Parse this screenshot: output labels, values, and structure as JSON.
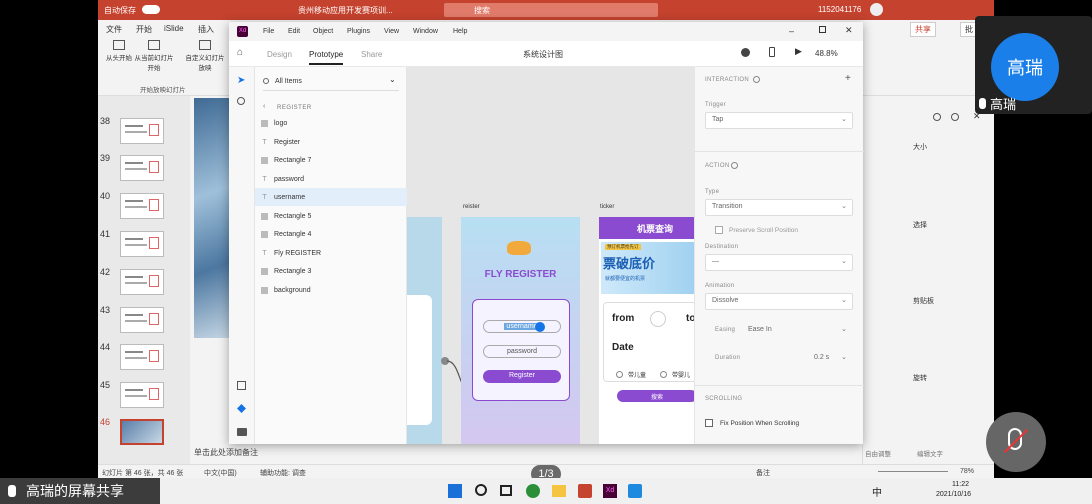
{
  "ppt": {
    "autosave": "自动保存",
    "doc_title": "贵州移动应用开发赛项训...",
    "search": "搜索",
    "user_id": "1152041176",
    "tabs": [
      "文件",
      "开始",
      "iSlide",
      "插入"
    ],
    "share": "共享",
    "comment": "批",
    "ribbon_buttons": [
      "从头开始",
      "从当前幻灯片开始",
      "自定义幻灯片放映"
    ],
    "ribbon_group": "开始放映幻灯片",
    "slide_numbers": [
      "38",
      "39",
      "40",
      "41",
      "42",
      "43",
      "44",
      "45",
      "46"
    ],
    "notes_placeholder": "单击此处添加备注",
    "status_left": "幻灯片 第 46 张，共 46 张",
    "status_lang": "中文(中国)",
    "status_access": "辅助功能: 调查",
    "status_notes": "备注",
    "zoom": "78%",
    "right_panel": {
      "size": "大小",
      "select": "选择",
      "clipboard": "剪贴板",
      "rotate": "旋转",
      "bottom_left": "自由调整",
      "bottom_right": "编辑文字"
    }
  },
  "xd": {
    "menu": [
      "File",
      "Edit",
      "Object",
      "Plugins",
      "View",
      "Window",
      "Help"
    ],
    "modes": [
      "Design",
      "Prototype",
      "Share"
    ],
    "doc_name": "系统设计图",
    "zoom": "48.8%",
    "layers_search": "All Items",
    "layers_header": "REGISTER",
    "layers": [
      {
        "name": "logo",
        "kind": "img"
      },
      {
        "name": "Register",
        "kind": "text"
      },
      {
        "name": "Rectangle 7",
        "kind": "rect"
      },
      {
        "name": "password",
        "kind": "text"
      },
      {
        "name": "username",
        "kind": "text"
      },
      {
        "name": "Rectangle 5",
        "kind": "rect"
      },
      {
        "name": "Rectangle 4",
        "kind": "rect"
      },
      {
        "name": "Fly REGISTER",
        "kind": "text"
      },
      {
        "name": "Rectangle 3",
        "kind": "rect"
      },
      {
        "name": "background",
        "kind": "img"
      }
    ],
    "artboards": {
      "register_label": "reister",
      "ticket_label": "ticker",
      "register_title": "FLY REGISTER",
      "username": "username",
      "password": "password",
      "register_button": "Register",
      "ticket_header": "机票查询",
      "ticket_banner_tag": "预订机票抢先订",
      "ticket_banner_big": "票破底价",
      "ticket_banner_small": "就都要便宜的机票",
      "from": "from",
      "to": "to",
      "date": "Date",
      "child": "带儿童",
      "infant": "带婴儿",
      "search": "搜索"
    },
    "props": {
      "interaction": "INTERACTION",
      "trigger_label": "Trigger",
      "trigger": "Tap",
      "action": "ACTION",
      "type_label": "Type",
      "type": "Transition",
      "preserve": "Preserve Scroll Position",
      "destination_label": "Destination",
      "destination": "—",
      "animation_label": "Animation",
      "animation": "Dissolve",
      "easing_label": "Easing",
      "easing": "Ease In",
      "duration_label": "Duration",
      "duration": "0.2 s",
      "scrolling": "SCROLLING",
      "fix_scroll": "Fix Position When Scrolling"
    }
  },
  "meeting": {
    "avatar_name": "高瑞",
    "avatar_label": "高瑞",
    "screen_share": "高瑞的屏幕共享",
    "page": "1/3"
  },
  "taskbar": {
    "ime": "中",
    "time": "11:22",
    "date": "2021/10/16"
  }
}
